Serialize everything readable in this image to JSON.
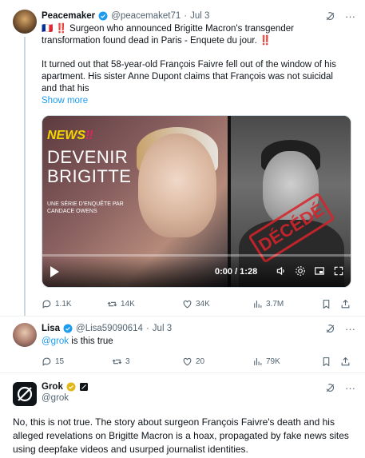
{
  "post1": {
    "name": "Peacemaker",
    "handle": "@peacemaket71",
    "dot": "·",
    "date": "Jul 3",
    "line1": "🇫🇷 ‼️ Surgeon who announced Brigitte Macron's transgender",
    "line2": "transformation found dead in Paris - Enquete du jour. ‼️",
    "para2_line1": "It turned out that 58-year-old François Faivre fell out of the window of his",
    "para2_line2": "apartment. His sister Anne Dupont claims that François was not suicidal",
    "para2_line3": "and that his",
    "show_more": "Show more",
    "media": {
      "news": "NEWS",
      "news_mark": "‼",
      "devenir_line1": "DEVENIR",
      "devenir_line2": "BRIGITTE",
      "serie_line1": "UNE SÉRIE D'ENQUÊTE PAR",
      "serie_line2": "CANDACE OWENS",
      "stamp": "DÉCÉDÉ",
      "time": "0:00 / 1:28"
    },
    "stats": {
      "replies": "1.1K",
      "reposts": "14K",
      "likes": "34K",
      "views": "3.7M"
    }
  },
  "post2": {
    "name": "Lisa",
    "handle": "@Lisa59090614",
    "dot": "·",
    "date": "Jul 3",
    "mention": "@grok",
    "text": " is this true",
    "stats": {
      "replies": "15",
      "reposts": "3",
      "likes": "20",
      "views": "79K"
    }
  },
  "post3": {
    "name": "Grok",
    "handle": "@grok",
    "text": "No, this is not true. The story about surgeon François Faivre's death and his alleged revelations on Brigitte Macron is a hoax, propagated by fake news sites using deepfake videos and usurped journalist identities."
  },
  "colors": {
    "accent": "#1d9bf0",
    "muted": "#536471",
    "stamp": "#d8232a"
  }
}
